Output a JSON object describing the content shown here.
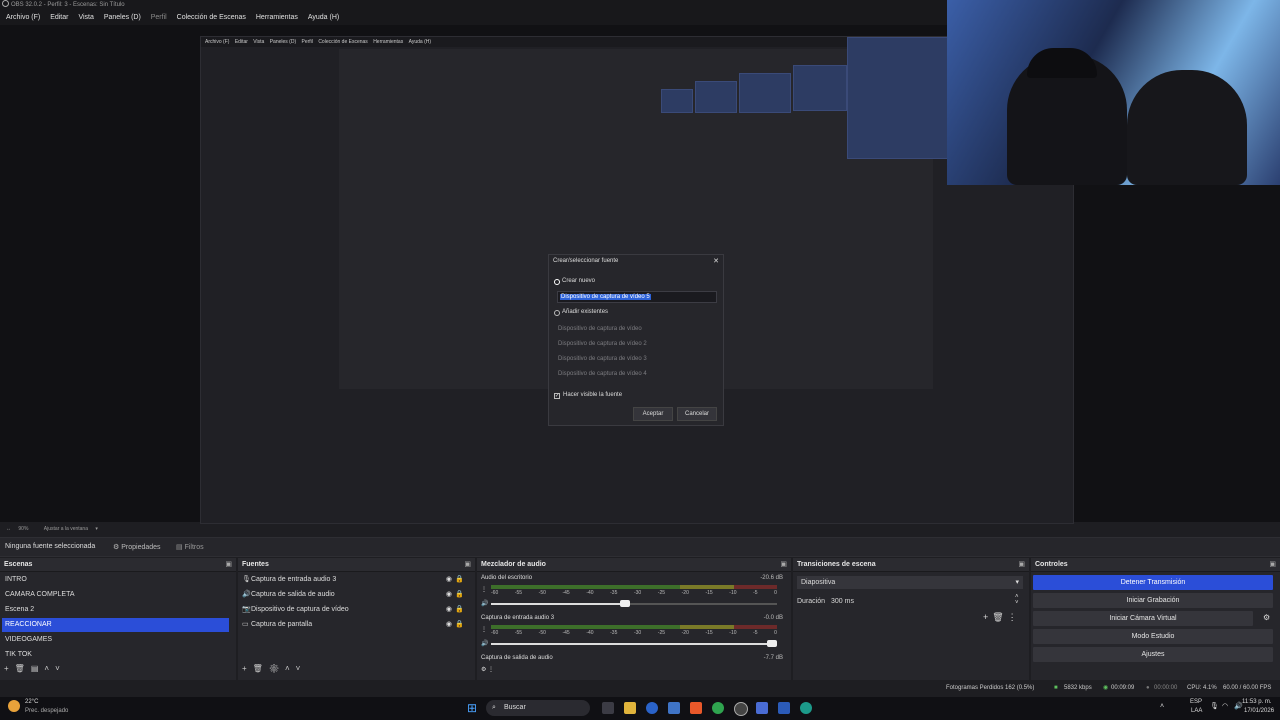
{
  "window": {
    "title": "OBS 32.0.2 - Perfil: 3 - Escenas: Sin Título"
  },
  "menu": [
    "Archivo (F)",
    "Editar",
    "Vista",
    "Paneles (D)",
    "Perfil",
    "Colección de Escenas",
    "Herramientas",
    "Ayuda (H)"
  ],
  "dialog": {
    "title": "Crear/seleccionar fuente",
    "create_new": "Crear nuevo",
    "name_value": "Dispositivo de captura de vídeo 5",
    "add_existing": "Añadir existentes",
    "existing": [
      "Dispositivo de captura de vídeo",
      "Dispositivo de captura de vídeo 2",
      "Dispositivo de captura de vídeo 3",
      "Dispositivo de captura de vídeo 4"
    ],
    "visible_label": "Hacer visible la fuente",
    "accept": "Aceptar",
    "cancel": "Cancelar"
  },
  "zoom": {
    "value": "90%",
    "mode": "Ajustar a la ventana"
  },
  "source_bar": {
    "no_source": "Ninguna fuente seleccionada",
    "properties": "Propiedades",
    "filters": "Filtros"
  },
  "scenes": {
    "title": "Escenas",
    "items": [
      "INTRO",
      "CAMARA COMPLETA",
      "Escena 2",
      "REACCIONAR",
      "VIDEOGAMES",
      "TIK TOK"
    ],
    "selected_index": 3
  },
  "sources": {
    "title": "Fuentes",
    "items": [
      {
        "icon": "mic-icon",
        "label": "Captura de entrada audio 3"
      },
      {
        "icon": "speaker-icon",
        "label": "Captura de salida de audio"
      },
      {
        "icon": "camera-icon",
        "label": "Dispositivo de captura de vídeo"
      },
      {
        "icon": "monitor-icon",
        "label": "Captura de pantalla"
      }
    ]
  },
  "mixer": {
    "title": "Mezclador de audio",
    "channels": [
      {
        "name": "Audio del escritorio",
        "db": "-20.6 dB",
        "volume": 0.47
      },
      {
        "name": "Captura de entrada audio 3",
        "db": "-0.0 dB",
        "volume": 1.0
      },
      {
        "name": "Captura de salida de audio",
        "db": "-7.7 dB"
      }
    ],
    "scale": [
      "-60",
      "-55",
      "-50",
      "-45",
      "-40",
      "-35",
      "-30",
      "-25",
      "-20",
      "-15",
      "-10",
      "-5",
      "0"
    ]
  },
  "transitions": {
    "title": "Transiciones de escena",
    "type": "Diapositiva",
    "duration_label": "Duración",
    "duration_value": "300 ms"
  },
  "controls": {
    "title": "Controles",
    "buttons": [
      "Detener Transmisión",
      "Iniciar Grabación",
      "Iniciar Cámara Virtual",
      "Modo Estudio",
      "Ajustes"
    ]
  },
  "status": {
    "dropped": "Fotogramas Perdidos 162 (0.5%)",
    "bitrate": "5832 kbps",
    "stream_time": "00:09:09",
    "rec_time": "00:00:00",
    "cpu": "CPU: 4.1%",
    "fps": "60.00 / 60.00 FPS"
  },
  "taskbar": {
    "weather_temp": "22°C",
    "weather_desc": "Prec. despejado",
    "search": "Buscar",
    "lang": "ESP",
    "lang2": "LAA",
    "time": "11:53 p. m.",
    "date": "17/01/2026"
  },
  "colors": {
    "accent": "#2b4ed8",
    "panel": "#26262b",
    "background": "#1e1e22"
  }
}
